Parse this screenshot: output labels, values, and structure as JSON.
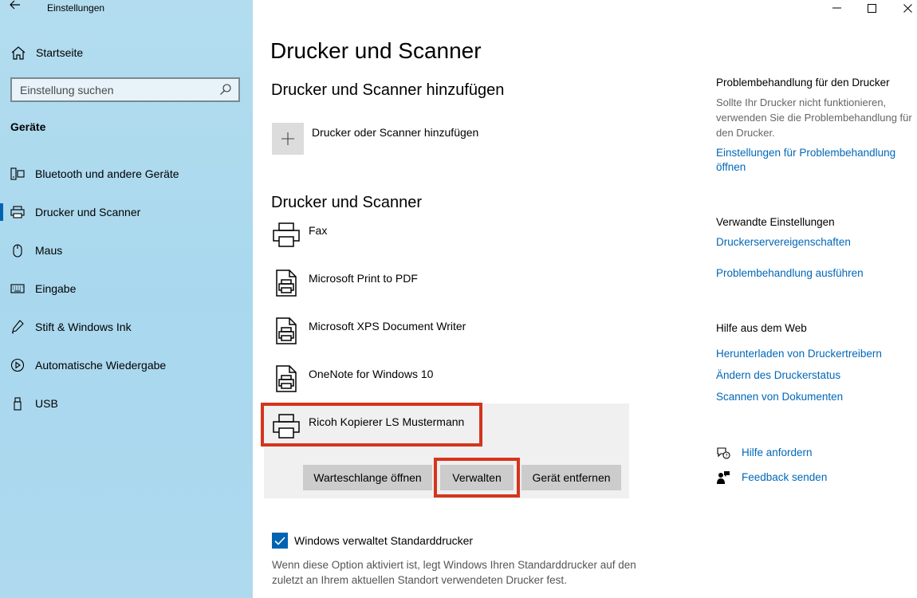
{
  "window": {
    "title": "Einstellungen"
  },
  "sidebar": {
    "home_label": "Startseite",
    "search_placeholder": "Einstellung suchen",
    "section": "Geräte",
    "items": [
      {
        "label": "Bluetooth und andere Geräte",
        "icon": "bluetooth-devices-icon"
      },
      {
        "label": "Drucker und Scanner",
        "icon": "printer-icon",
        "active": true
      },
      {
        "label": "Maus",
        "icon": "mouse-icon"
      },
      {
        "label": "Eingabe",
        "icon": "keyboard-icon"
      },
      {
        "label": "Stift & Windows Ink",
        "icon": "pen-icon"
      },
      {
        "label": "Automatische Wiedergabe",
        "icon": "autoplay-icon"
      },
      {
        "label": "USB",
        "icon": "usb-icon"
      }
    ]
  },
  "main": {
    "title": "Drucker und Scanner",
    "add_section": "Drucker und Scanner hinzufügen",
    "add_label": "Drucker oder Scanner hinzufügen",
    "list_section": "Drucker und Scanner",
    "printers": [
      {
        "name": "Fax"
      },
      {
        "name": "Microsoft Print to PDF"
      },
      {
        "name": "Microsoft XPS Document Writer"
      },
      {
        "name": "OneNote for Windows 10"
      },
      {
        "name": "Ricoh Kopierer LS Mustermann",
        "selected": true
      }
    ],
    "buttons": {
      "queue": "Warteschlange öffnen",
      "manage": "Verwalten",
      "remove": "Gerät entfernen"
    },
    "default_printer": {
      "checked": true,
      "label": "Windows verwaltet Standarddrucker",
      "description": "Wenn diese Option aktiviert ist, legt Windows Ihren Standarddrucker auf den zuletzt an Ihrem aktuellen Standort verwendeten Drucker fest."
    }
  },
  "right": {
    "trouble": {
      "heading": "Problembehandlung für den Drucker",
      "text": "Sollte Ihr Drucker nicht funktionieren, verwenden Sie die Problembehandlung für den Drucker.",
      "link": "Einstellungen für Problembehandlung öffnen"
    },
    "related": {
      "heading": "Verwandte Einstellungen",
      "links": [
        "Druckerservereigenschaften",
        "Problembehandlung ausführen"
      ]
    },
    "web": {
      "heading": "Hilfe aus dem Web",
      "links": [
        "Herunterladen von Druckertreibern",
        "Ändern des Druckerstatus",
        "Scannen von Dokumenten"
      ]
    },
    "help": {
      "get_help": "Hilfe anfordern",
      "feedback": "Feedback senden"
    }
  },
  "colors": {
    "accent": "#0063b1",
    "link": "#0067b8",
    "highlight": "#d4351c"
  }
}
